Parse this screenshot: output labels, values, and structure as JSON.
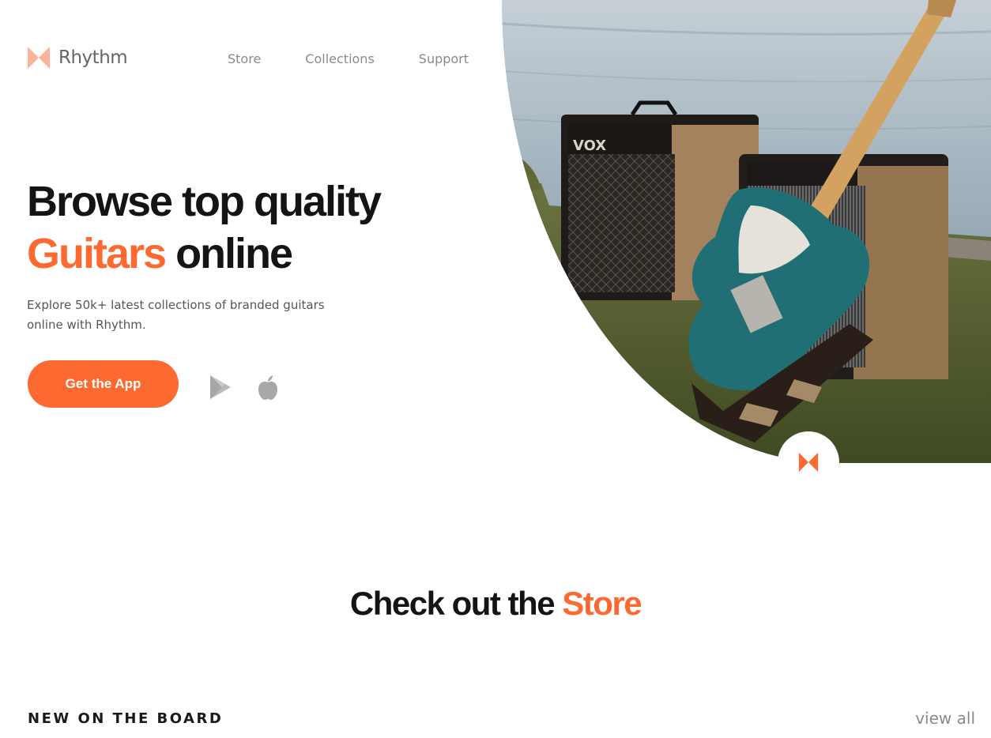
{
  "brand": {
    "name": "Rhythm",
    "color": "#fd6a31"
  },
  "nav": {
    "items": [
      "Store",
      "Collections",
      "Support"
    ]
  },
  "hero": {
    "title_line1": "Browse top quality",
    "title_accent": "Guitars",
    "title_rest": " online",
    "description": "Explore 50k+ latest collections of branded guitars online with Rhythm.",
    "cta_label": "Get the App",
    "store_icons": [
      "google-play-icon",
      "apple-icon"
    ]
  },
  "store_section": {
    "title_prefix": "Check out the ",
    "title_accent": "Store",
    "subheading": "NEW ON THE BOARD",
    "view_all_label": "view all"
  }
}
